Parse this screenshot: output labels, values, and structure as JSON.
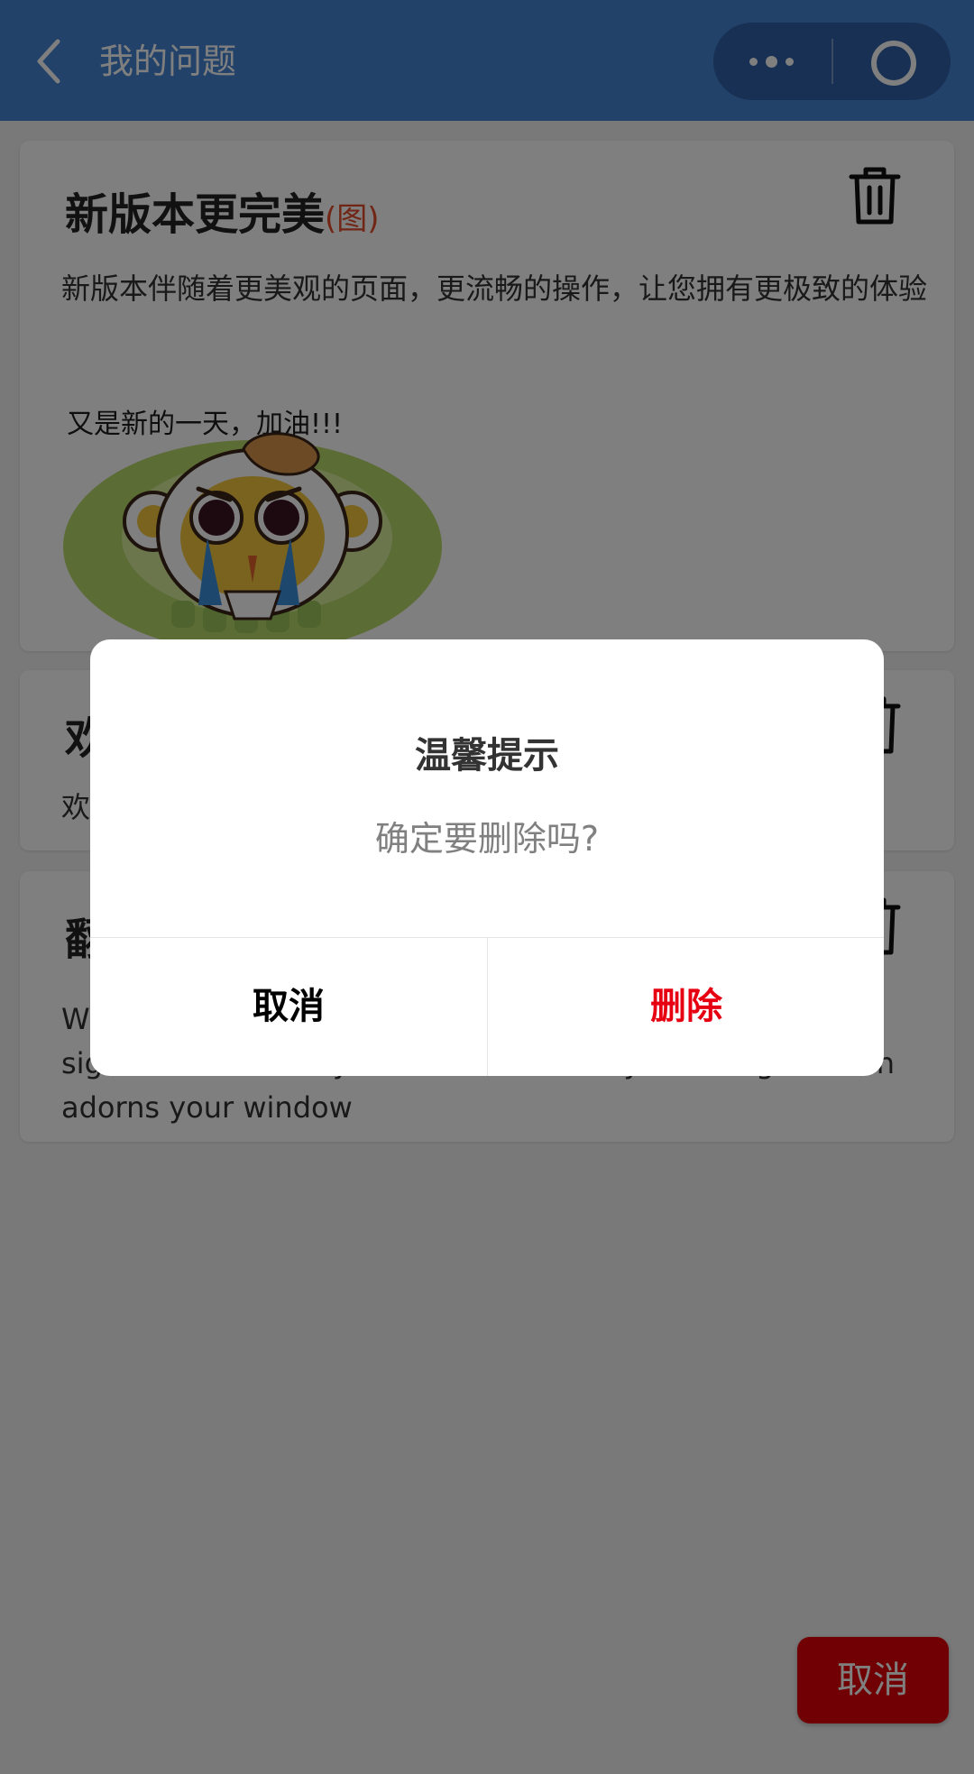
{
  "header": {
    "title": "我的问题",
    "back_icon": "chevron-left-icon",
    "more_icon": "more-dots-icon",
    "close_icon": "target-circle-icon",
    "color": "#4584d5"
  },
  "cards": [
    {
      "title": "新版本更完美",
      "tag": "(图)",
      "body": "新版本伴随着更美观的页面，更流畅的操作，让您拥有更极致的体验",
      "sticker_text": "又是新的一天，加油!!!",
      "icon": "trash-icon"
    },
    {
      "title": "欢",
      "body": "欢",
      "icon": "trash-icon"
    },
    {
      "title": "翻",
      "body_lines": [
        "W",
        "sightseer watches you from the balcony. The bright moon",
        "adorns your window"
      ],
      "icon": "trash-icon"
    }
  ],
  "dialog": {
    "title": "温馨提示",
    "message": "确定要删除吗?",
    "cancel_label": "取消",
    "delete_label": "删除",
    "delete_color": "#e60012"
  },
  "floating_button": {
    "label": "取消",
    "color": "#e00006"
  }
}
